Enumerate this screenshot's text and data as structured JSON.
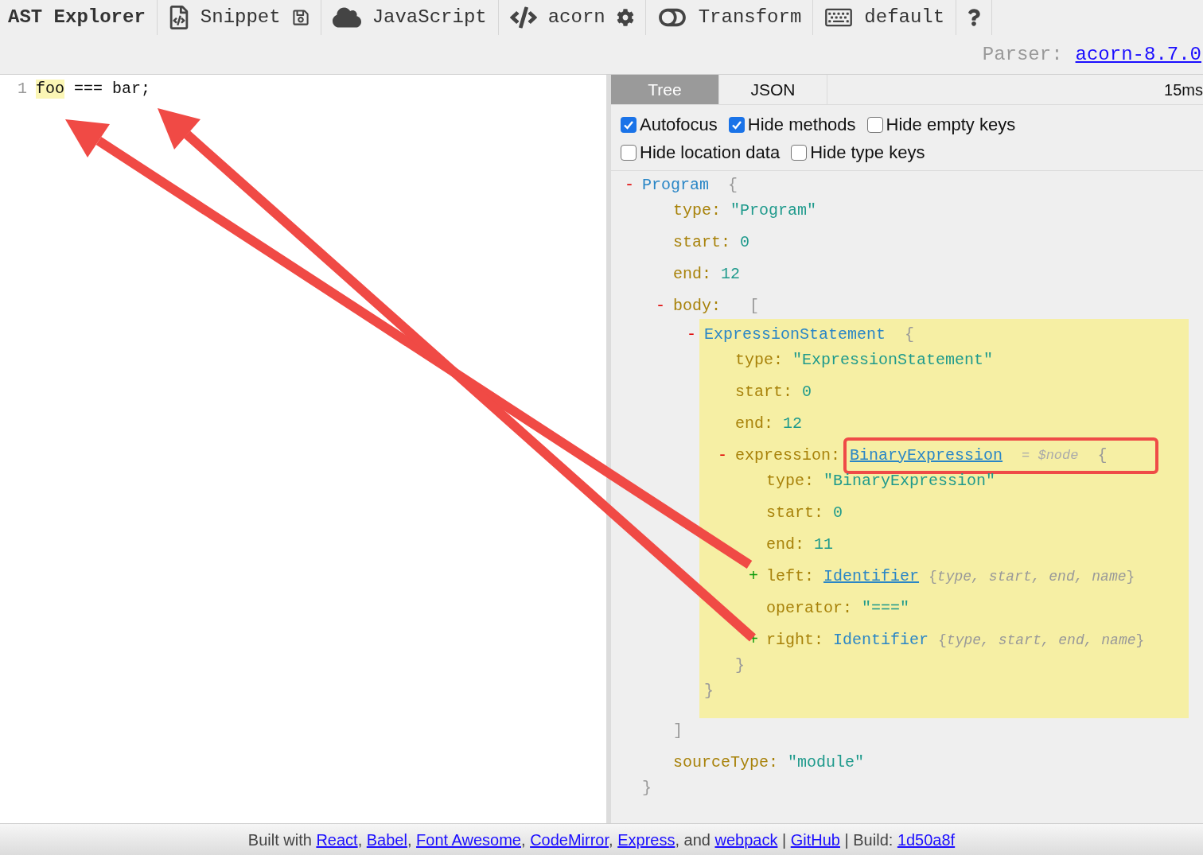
{
  "toolbar": {
    "title": "AST Explorer",
    "snippet": {
      "label": "Snippet"
    },
    "language": {
      "label": "JavaScript"
    },
    "parser": {
      "label": "acorn"
    },
    "transform": {
      "label": "Transform",
      "enabled": false
    },
    "keymap": {
      "label": "default"
    }
  },
  "parser_info": {
    "label": "Parser:",
    "version": "acorn-8.7.0"
  },
  "editor": {
    "lines": [
      {
        "number": "1",
        "tokens": [
          {
            "text": "foo",
            "highlighted": true
          },
          {
            "text": " === bar;",
            "highlighted": false
          }
        ]
      }
    ]
  },
  "tabs": [
    {
      "label": "Tree",
      "selected": true
    },
    {
      "label": "JSON",
      "selected": false
    }
  ],
  "timing": "15ms",
  "options": [
    {
      "items": [
        {
          "label": "Autofocus",
          "checked": true
        },
        {
          "label": "Hide methods",
          "checked": true
        },
        {
          "label": "Hide empty keys",
          "checked": false
        }
      ]
    },
    {
      "items": [
        {
          "label": "Hide location data",
          "checked": false
        },
        {
          "label": "Hide type keys",
          "checked": false
        }
      ]
    }
  ],
  "tree": {
    "kind": "node",
    "toggle": "-",
    "name": "Program",
    "open": "{",
    "close": "}",
    "expanded": true,
    "children": [
      {
        "kind": "prop",
        "key": "type:",
        "value": "\"Program\""
      },
      {
        "kind": "prop",
        "key": "start:",
        "value": "0"
      },
      {
        "kind": "prop",
        "key": "end:",
        "value": "12"
      },
      {
        "kind": "array",
        "key": "body:",
        "toggle": "-",
        "open": "[",
        "close": "]",
        "expanded": true,
        "children": [
          {
            "kind": "node",
            "toggle": "-",
            "name": "ExpressionStatement",
            "open": "{",
            "close": "}",
            "expanded": true,
            "highlighted": true,
            "children": [
              {
                "kind": "prop",
                "key": "type:",
                "value": "\"ExpressionStatement\""
              },
              {
                "kind": "prop",
                "key": "start:",
                "value": "0"
              },
              {
                "kind": "prop",
                "key": "end:",
                "value": "12"
              },
              {
                "kind": "node",
                "key": "expression:",
                "toggle": "-",
                "name": "BinaryExpression",
                "annotation": "= $node",
                "open": "{",
                "close": "}",
                "expanded": true,
                "underlined": true,
                "outlined": true,
                "children": [
                  {
                    "kind": "prop",
                    "key": "type:",
                    "value": "\"BinaryExpression\""
                  },
                  {
                    "kind": "prop",
                    "key": "start:",
                    "value": "0"
                  },
                  {
                    "kind": "prop",
                    "key": "end:",
                    "value": "11"
                  },
                  {
                    "kind": "node",
                    "key": "left:",
                    "toggle": "+",
                    "name": "Identifier",
                    "summary": "{*type, start, end, name*}",
                    "expanded": false,
                    "underlined": true
                  },
                  {
                    "kind": "prop",
                    "key": "operator:",
                    "value": "\"===\""
                  },
                  {
                    "kind": "node",
                    "key": "right:",
                    "toggle": "+",
                    "name": "Identifier",
                    "summary": "{*type, start, end, name*}",
                    "expanded": false,
                    "underlined": false
                  }
                ]
              }
            ]
          }
        ]
      },
      {
        "kind": "prop",
        "key": "sourceType:",
        "value": "\"module\""
      }
    ]
  },
  "footer": {
    "parts": [
      {
        "kind": "text",
        "text": "Built with "
      },
      {
        "kind": "link",
        "text": "React"
      },
      {
        "kind": "text",
        "text": ", "
      },
      {
        "kind": "link",
        "text": "Babel"
      },
      {
        "kind": "text",
        "text": ", "
      },
      {
        "kind": "link",
        "text": "Font Awesome"
      },
      {
        "kind": "text",
        "text": ", "
      },
      {
        "kind": "link",
        "text": "CodeMirror"
      },
      {
        "kind": "text",
        "text": ", "
      },
      {
        "kind": "link",
        "text": "Express"
      },
      {
        "kind": "text",
        "text": ", and "
      },
      {
        "kind": "link",
        "text": "webpack"
      },
      {
        "kind": "text",
        "text": " | "
      },
      {
        "kind": "link",
        "text": "GitHub"
      },
      {
        "kind": "text",
        "text": " | Build: "
      },
      {
        "kind": "link",
        "text": "1d50a8f"
      }
    ]
  }
}
